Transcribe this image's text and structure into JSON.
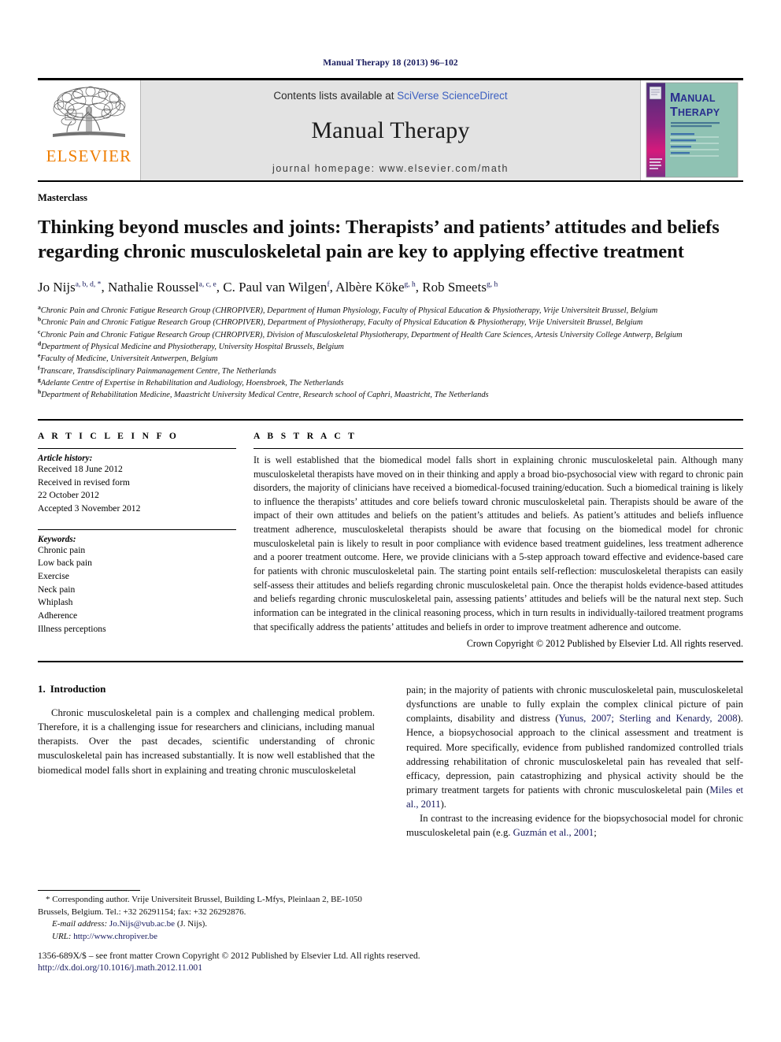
{
  "running_head": "Manual Therapy 18 (2013) 96–102",
  "masthead": {
    "elsevier_wordmark": "ELSEVIER",
    "contents_prefix": "Contents lists available at ",
    "contents_link": "SciVerse ScienceDirect",
    "journal_name": "Manual Therapy",
    "journal_homepage": "journal homepage: www.elsevier.com/math",
    "cover": {
      "title_line1": "MANUAL",
      "title_line2": "THERAPY",
      "subtitle": "AN INTERNATIONAL JOURNAL OF MUSCULOSKELETAL MEDICINE",
      "spine_caption": "Official journal of the International Federation of Orthopaedic Manipulative Physical Therapists",
      "bg_color": "#8fc2b3",
      "spine_color": "#c7186e",
      "title_color": "#2a2f8f"
    }
  },
  "article_type": "Masterclass",
  "title": "Thinking beyond muscles and joints: Therapists’ and patients’ attitudes and beliefs regarding chronic musculoskeletal pain are key to applying effective treatment",
  "authors": [
    {
      "name": "Jo Nijs",
      "sup": "a, b, d, *"
    },
    {
      "name": "Nathalie Roussel",
      "sup": "a, c, e"
    },
    {
      "name": "C. Paul van Wilgen",
      "sup": "f"
    },
    {
      "name": "Albère Köke",
      "sup": "g, h"
    },
    {
      "name": "Rob Smeets",
      "sup": "g, h"
    }
  ],
  "affiliations": [
    {
      "mark": "a",
      "text": "Chronic Pain and Chronic Fatigue Research Group (CHROPIVER), Department of Human Physiology, Faculty of Physical Education & Physiotherapy, Vrije Universiteit Brussel, Belgium"
    },
    {
      "mark": "b",
      "text": "Chronic Pain and Chronic Fatigue Research Group (CHROPIVER), Department of Physiotherapy, Faculty of Physical Education & Physiotherapy, Vrije Universiteit Brussel, Belgium"
    },
    {
      "mark": "c",
      "text": "Chronic Pain and Chronic Fatigue Research Group (CHROPIVER), Division of Musculoskeletal Physiotherapy, Department of Health Care Sciences, Artesis University College Antwerp, Belgium"
    },
    {
      "mark": "d",
      "text": "Department of Physical Medicine and Physiotherapy, University Hospital Brussels, Belgium"
    },
    {
      "mark": "e",
      "text": "Faculty of Medicine, Universiteit Antwerpen, Belgium"
    },
    {
      "mark": "f",
      "text": "Transcare, Transdisciplinary Painmanagement Centre, The Netherlands"
    },
    {
      "mark": "g",
      "text": "Adelante Centre of Expertise in Rehabilitation and Audiology, Hoensbroek, The Netherlands"
    },
    {
      "mark": "h",
      "text": "Department of Rehabilitation Medicine, Maastricht University Medical Centre, Research school of Caphri, Maastricht, The Netherlands"
    }
  ],
  "article_info": {
    "heading": "A R T I C L E   I N F O",
    "history_label": "Article history:",
    "history": [
      "Received 18 June 2012",
      "Received in revised form",
      "22 October 2012",
      "Accepted 3 November 2012"
    ],
    "keywords_label": "Keywords:",
    "keywords": [
      "Chronic pain",
      "Low back pain",
      "Exercise",
      "Neck pain",
      "Whiplash",
      "Adherence",
      "Illness perceptions"
    ]
  },
  "abstract": {
    "heading": "A B S T R A C T",
    "body": "It is well established that the biomedical model falls short in explaining chronic musculoskeletal pain. Although many musculoskeletal therapists have moved on in their thinking and apply a broad bio-psychosocial view with regard to chronic pain disorders, the majority of clinicians have received a biomedical-focused training/education. Such a biomedical training is likely to influence the therapists’ attitudes and core beliefs toward chronic musculoskeletal pain. Therapists should be aware of the impact of their own attitudes and beliefs on the patient’s attitudes and beliefs. As patient’s attitudes and beliefs influence treatment adherence, musculoskeletal therapists should be aware that focusing on the biomedical model for chronic musculoskeletal pain is likely to result in poor compliance with evidence based treatment guidelines, less treatment adherence and a poorer treatment outcome. Here, we provide clinicians with a 5-step approach toward effective and evidence-based care for patients with chronic musculoskeletal pain. The starting point entails self-reflection: musculoskeletal therapists can easily self-assess their attitudes and beliefs regarding chronic musculoskeletal pain. Once the therapist holds evidence-based attitudes and beliefs regarding chronic musculoskeletal pain, assessing patients’ attitudes and beliefs will be the natural next step. Such information can be integrated in the clinical reasoning process, which in turn results in individually-tailored treatment programs that specifically address the patients’ attitudes and beliefs in order to improve treatment adherence and outcome.",
    "copyright": "Crown Copyright © 2012 Published by Elsevier Ltd. All rights reserved."
  },
  "introduction": {
    "number": "1.",
    "heading": "Introduction",
    "left_paragraph": "Chronic musculoskeletal pain is a complex and challenging medical problem. Therefore, it is a challenging issue for researchers and clinicians, including manual therapists. Over the past decades, scientific understanding of chronic musculoskeletal pain has increased substantially. It is now well established that the biomedical model falls short in explaining and treating chronic musculoskeletal",
    "right_paragraph_1_pre": "pain; in the majority of patients with chronic musculoskeletal pain, musculoskeletal dysfunctions are unable to fully explain the complex clinical picture of pain complaints, disability and distress (",
    "right_paragraph_1_ref": "Yunus, 2007; Sterling and Kenardy, 2008",
    "right_paragraph_1_mid": "). Hence, a biopsychosocial approach to the clinical assessment and treatment is required. More specifically, evidence from published randomized controlled trials addressing rehabilitation of chronic musculoskeletal pain has revealed that self-efficacy, depression, pain catastrophizing and physical activity should be the primary treatment targets for patients with chronic musculoskeletal pain (",
    "right_paragraph_1_ref2": "Miles et al., 2011",
    "right_paragraph_1_post": ").",
    "right_paragraph_2_pre": "In contrast to the increasing evidence for the biopsychosocial model for chronic musculoskeletal pain (e.g. ",
    "right_paragraph_2_ref": "Guzmán et al., 2001",
    "right_paragraph_2_post": ";"
  },
  "footnote": {
    "corresponding": "* Corresponding author. Vrije Universiteit Brussel, Building L-Mfys, Pleinlaan 2, BE-1050 Brussels, Belgium. Tel.: +32 26291154; fax: +32 26292876.",
    "email_label": "E-mail address:",
    "email": "Jo.Nijs@vub.ac.be",
    "email_suffix": "(J. Nijs).",
    "url_label": "URL:",
    "url": "http://www.chropiver.be"
  },
  "bottom": {
    "issn_line": "1356-689X/$ – see front matter Crown Copyright © 2012 Published by Elsevier Ltd. All rights reserved.",
    "doi": "http://dx.doi.org/10.1016/j.math.2012.11.001"
  }
}
